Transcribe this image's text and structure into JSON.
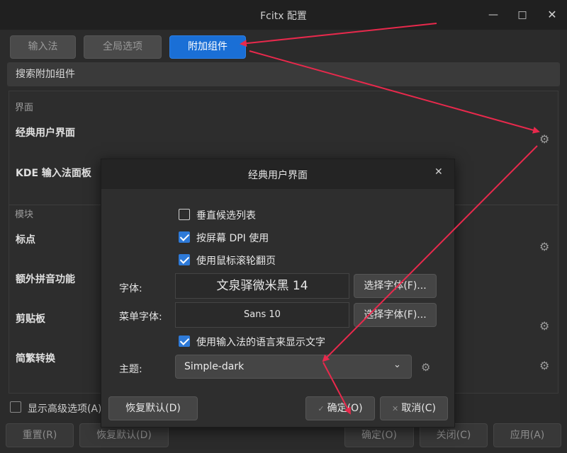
{
  "window": {
    "title": "Fcitx 配置"
  },
  "tabs": [
    {
      "label": "输入法"
    },
    {
      "label": "全局选项"
    },
    {
      "label": "附加组件"
    }
  ],
  "search": {
    "placeholder": "搜索附加组件"
  },
  "list": {
    "section_ui": "界面",
    "section_modules": "模块",
    "items": [
      "经典用户界面",
      "KDE 输入法面板",
      "标点",
      "额外拼音功能",
      "剪贴板",
      "简繁转换"
    ]
  },
  "advanced_label": "显示高级选项(A)",
  "bottom_buttons": {
    "reset": "重置(R)",
    "defaults": "恢复默认(D)",
    "ok": "确定(O)",
    "close": "关闭(C)",
    "apply": "应用(A)"
  },
  "dialog": {
    "title": "经典用户界面",
    "vertical_list": {
      "label": "垂直候选列表",
      "checked": false
    },
    "per_screen_dpi": {
      "label": "按屏幕 DPI 使用",
      "checked": true
    },
    "wheel_page": {
      "label": "使用鼠标滚轮翻页",
      "checked": true
    },
    "font_label": "字体:",
    "font_value": "文泉驿微米黑 14",
    "menu_font_label": "菜单字体:",
    "menu_font_value": "Sans 10",
    "choose_font": "选择字体(F)...",
    "use_im_lang": {
      "label": "使用输入法的语言来显示文字",
      "checked": true
    },
    "theme_label": "主题:",
    "theme_value": "Simple-dark",
    "btn_defaults": "恢复默认(D)",
    "btn_ok": "确定(O)",
    "btn_cancel": "取消(C)"
  },
  "colors": {
    "accent": "#1a6fd6",
    "annotation": "#e8294c"
  }
}
